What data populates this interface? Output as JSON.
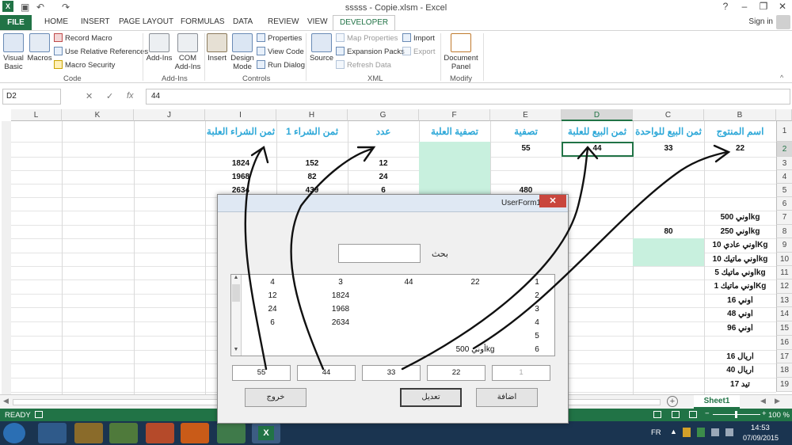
{
  "window": {
    "title": "sssss - Copie.xlsm - Excel",
    "minimize": "–",
    "restore": "❐",
    "close": "✕",
    "help": "?",
    "qat_undo": "↶",
    "qat_redo": "↷"
  },
  "tabs": {
    "items": [
      "FILE",
      "HOME",
      "INSERT",
      "PAGE LAYOUT",
      "FORMULAS",
      "DATA",
      "REVIEW",
      "VIEW",
      "DEVELOPER"
    ],
    "active": "DEVELOPER",
    "signin": "Sign in"
  },
  "ribbon": {
    "code": {
      "group": "Code",
      "visual_basic": "Visual Basic",
      "macros": "Macros",
      "record_macro": "Record Macro",
      "relative_refs": "Use Relative References",
      "macro_security": "Macro Security"
    },
    "addins": {
      "group": "Add-Ins",
      "addins": "Add-Ins",
      "com": "COM Add-Ins"
    },
    "controls": {
      "group": "Controls",
      "insert": "Insert",
      "design_mode": "Design Mode",
      "properties": "Properties",
      "view_code": "View Code",
      "run_dialog": "Run Dialog"
    },
    "xml": {
      "group": "XML",
      "source": "Source",
      "map_properties": "Map Properties",
      "expansion_packs": "Expansion Packs",
      "refresh_data": "Refresh Data",
      "import": "Import",
      "export": "Export"
    },
    "modify": {
      "group": "Modify",
      "document_panel": "Document Panel"
    }
  },
  "formula_bar": {
    "name_box": "D2",
    "fx": "fx",
    "cancel": "✕",
    "enter": "✓",
    "value": "44"
  },
  "columns": [
    "L",
    "K",
    "J",
    "I",
    "H",
    "G",
    "F",
    "E",
    "D",
    "C",
    "B"
  ],
  "rows": [
    "1",
    "2",
    "3",
    "4",
    "5",
    "6",
    "7",
    "8",
    "9",
    "10",
    "11",
    "12",
    "13",
    "14",
    "15",
    "16",
    "17",
    "18",
    "19"
  ],
  "headers": {
    "I": "ثمن الشراء العلبة",
    "H": "ثمن الشراء 1",
    "G": "عدد",
    "F": "تصفية العلبة",
    "E": "تصفية",
    "D": "ثمن البيع للعلبة",
    "C": "ثمن البيع للواحدة",
    "B": "اسم المنتوج"
  },
  "cells": {
    "E2": "55",
    "D2": "44",
    "C2": "33",
    "B2": "22",
    "I3": "1824",
    "H3": "152",
    "G3": "12",
    "I4": "1968",
    "H4": "82",
    "G4": "24",
    "I5": "2634",
    "H5": "439",
    "G5": "6",
    "E5": "480",
    "B7": "أوني 500kg",
    "C8": "80",
    "B8": "أوني 250kg",
    "B9": "أوني عادي 10Kg",
    "B10": "أوني ماتيك 10kg",
    "B11": "أوني ماتيك 5kg",
    "B12": "أوني ماتيك 1Kg",
    "B13": "أوني 16",
    "B14": "أوني 48",
    "B15": "أوني 96",
    "B17": "أريال 16",
    "B18": "أريال 40",
    "B19": "تيد 17"
  },
  "sheet_tab": "Sheet1",
  "sheet_add": "+",
  "status": {
    "ready": "READY",
    "zoom": "100 %"
  },
  "taskbar": {
    "lang": "FR",
    "time": "14:53",
    "date": "07/09/2015"
  },
  "userform": {
    "title": "UserForm1",
    "close": "✕",
    "search_label": "بحث",
    "search_value": "",
    "list_rows": [
      [
        "4",
        "3",
        "44",
        "22",
        "1"
      ],
      [
        "12",
        "1824",
        "",
        "",
        "2"
      ],
      [
        "24",
        "1968",
        "",
        "",
        "3"
      ],
      [
        "6",
        "2634",
        "",
        "",
        "4"
      ],
      [
        "",
        "",
        "",
        "",
        "5"
      ],
      [
        "",
        "",
        "",
        "أوني 500kg",
        "6"
      ]
    ],
    "textboxes": [
      "55",
      "44",
      "33",
      "22",
      "1"
    ],
    "btn_exit": "خروج",
    "btn_edit": "تعديل",
    "btn_add": "اضافة"
  },
  "colors": {
    "excel_green": "#217346",
    "header_text": "#2ea8d8",
    "mint_fill": "#c8f0de",
    "taskbar": "#1a3450"
  }
}
